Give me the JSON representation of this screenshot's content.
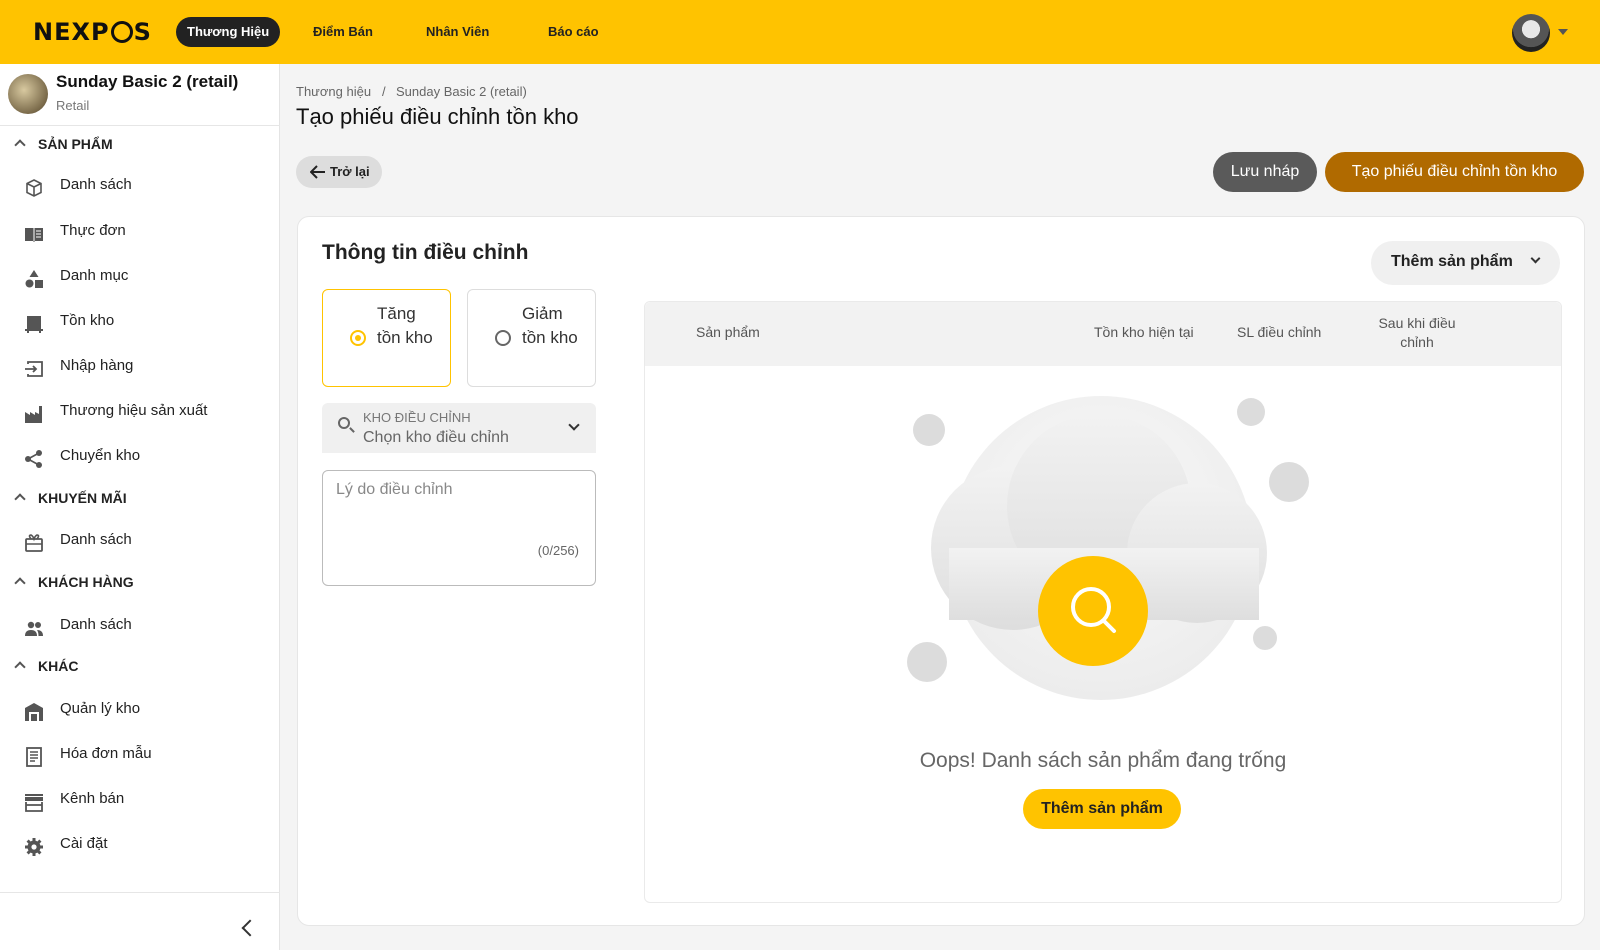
{
  "header": {
    "logo": "NEXPOS",
    "nav": [
      "Thương Hiệu",
      "Điểm Bán",
      "Nhân Viên",
      "Báo cáo"
    ]
  },
  "sidebar": {
    "store_name": "Sunday Basic 2 (retail)",
    "store_type": "Retail",
    "sections": [
      {
        "title": "SẢN PHẨM",
        "items": [
          {
            "label": "Danh sách",
            "icon": "box-icon"
          },
          {
            "label": "Thực đơn",
            "icon": "menu-book-icon"
          },
          {
            "label": "Danh mục",
            "icon": "category-icon"
          },
          {
            "label": "Tồn kho",
            "icon": "inventory-icon"
          },
          {
            "label": "Nhập hàng",
            "icon": "import-icon"
          },
          {
            "label": "Thương hiệu sản xuất",
            "icon": "factory-icon"
          },
          {
            "label": "Chuyển kho",
            "icon": "share-icon"
          }
        ]
      },
      {
        "title": "KHUYẾN MÃI",
        "items": [
          {
            "label": "Danh sách",
            "icon": "gift-icon"
          }
        ]
      },
      {
        "title": "KHÁCH HÀNG",
        "items": [
          {
            "label": "Danh sách",
            "icon": "people-icon"
          }
        ]
      },
      {
        "title": "KHÁC",
        "items": [
          {
            "label": "Quản lý kho",
            "icon": "warehouse-icon"
          },
          {
            "label": "Hóa đơn mẫu",
            "icon": "receipt-icon"
          },
          {
            "label": "Kênh bán",
            "icon": "store-icon"
          },
          {
            "label": "Cài đặt",
            "icon": "gear-icon"
          }
        ]
      }
    ]
  },
  "breadcrumb": [
    "Thương hiệu",
    "Sunday Basic 2 (retail)"
  ],
  "breadcrumb_sep": "/",
  "page_title": "Tạo phiếu điều chỉnh tồn kho",
  "actions": {
    "back": "Trở lại",
    "save_draft": "Lưu nháp",
    "create": "Tạo phiếu điều chỉnh tồn kho"
  },
  "form": {
    "title": "Thông tin điều chỉnh",
    "options": [
      {
        "label": "Tăng tồn kho",
        "selected": true
      },
      {
        "label": "Giảm tồn kho",
        "selected": false
      }
    ],
    "warehouse_label": "KHO ĐIỀU CHỈNH",
    "warehouse_placeholder": "Chọn kho điều chỉnh",
    "reason_placeholder": "Lý do điều chỉnh",
    "reason_counter": "(0/256)"
  },
  "products": {
    "add_dropdown": "Thêm sản phẩm",
    "columns": [
      "Sản phẩm",
      "Tồn kho hiện tại",
      "SL điều chỉnh",
      "Sau khi điều chỉnh"
    ],
    "empty_text": "Oops! Danh sách sản phẩm đang trống",
    "empty_button": "Thêm sản phẩm"
  },
  "colors": {
    "brand": "#FFC300",
    "primary_action": "#B06A00",
    "draft": "#5a5a5a"
  }
}
